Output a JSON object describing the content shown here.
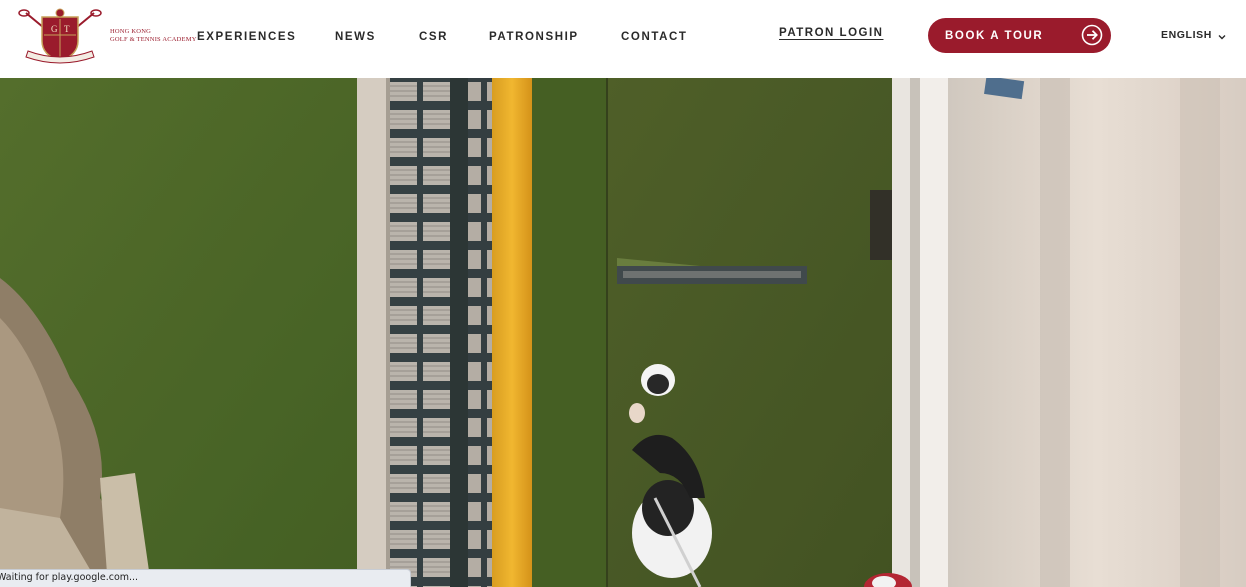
{
  "header": {
    "logo": {
      "name_line1": "HONG KONG",
      "name_line2": "GOLF & TENNIS ACADEMY",
      "crest_letters": [
        "G",
        "T"
      ]
    },
    "nav": [
      {
        "label": "EXPERIENCES"
      },
      {
        "label": "NEWS"
      },
      {
        "label": "CSR"
      },
      {
        "label": "PATRONSHIP"
      },
      {
        "label": "CONTACT"
      }
    ],
    "patron_login": "PATRON LOGIN",
    "book_tour": {
      "label": "BOOK A TOUR",
      "icon": "arrow-right-circle-icon"
    },
    "language": {
      "selected": "ENGLISH",
      "icon": "chevron-down-icon"
    }
  },
  "hero": {
    "media": "aerial video of golfer on driving range mat"
  },
  "status_bar": {
    "text": "Waiting for play.google.com..."
  },
  "colors": {
    "brand": "#9a1b2c",
    "nav_text": "#2a2a2a",
    "header_bg": "#ffffff"
  }
}
